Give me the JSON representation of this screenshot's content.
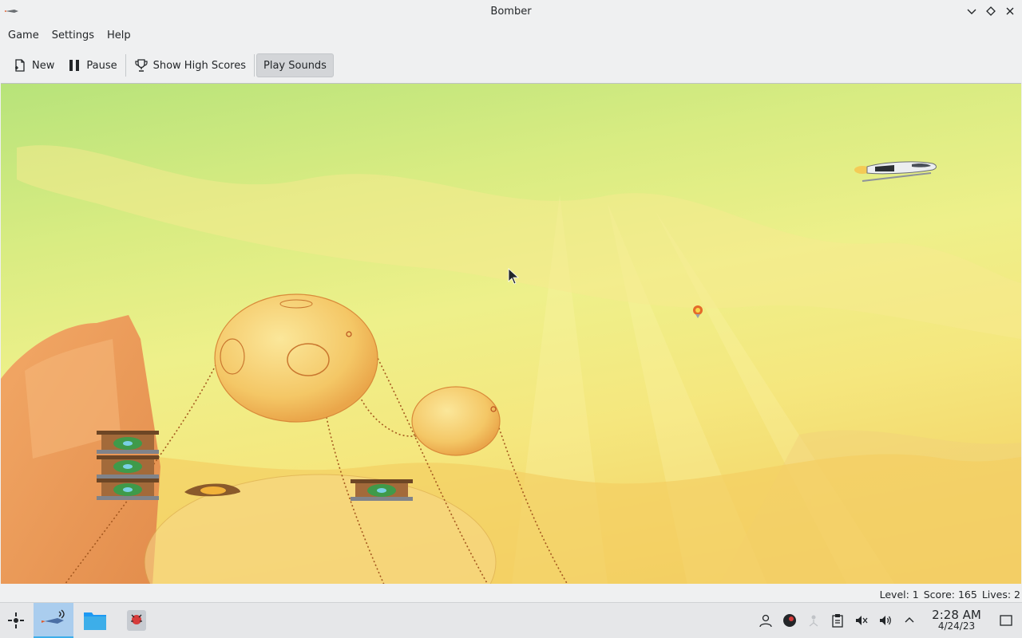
{
  "window": {
    "title": "Bomber"
  },
  "menu": [
    "Game",
    "Settings",
    "Help"
  ],
  "toolbar": {
    "new_label": "New",
    "pause_label": "Pause",
    "highscores_label": "Show High Scores",
    "sounds_label": "Play Sounds"
  },
  "status": {
    "level": "Level: 1",
    "score": "Score: 165",
    "lives": "Lives: 2"
  },
  "taskbar": {
    "tasks": [
      "bomber",
      "file-manager",
      "game-icon"
    ],
    "clock_time": "2:28 AM",
    "clock_date": "4/24/23"
  },
  "colors": {
    "accent": "#3daee9",
    "sky_top": "#b7e37a",
    "ground": "#f0c75c"
  }
}
